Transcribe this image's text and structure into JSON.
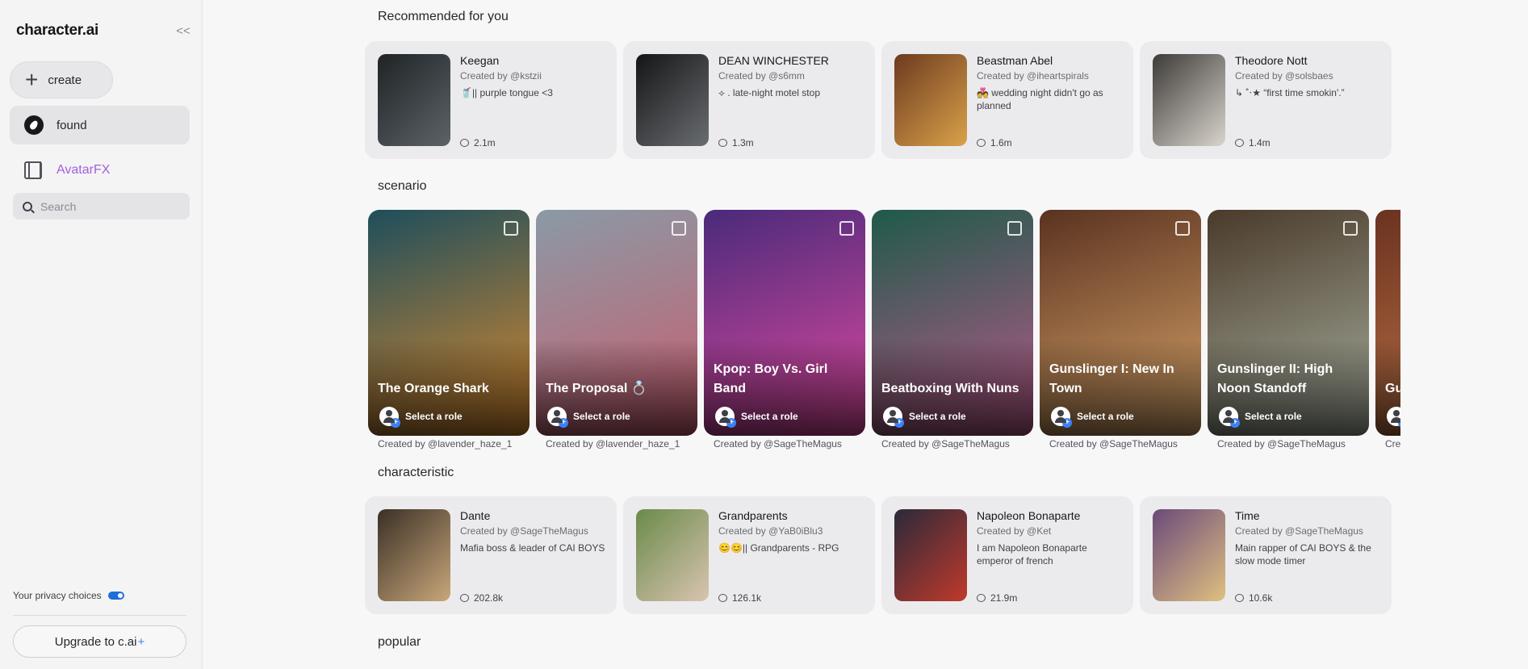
{
  "sidebar": {
    "logo": "character.ai",
    "collapse": "<<",
    "create_label": "create",
    "found_label": "found",
    "avatarfx_label": "AvatarFX",
    "search_placeholder": "Search",
    "privacy_label": "Your privacy choices",
    "upgrade_label": "Upgrade to c.ai",
    "upgrade_plus": "+"
  },
  "sections": {
    "recommended": "Recommended for you",
    "scenario": "scenario",
    "characteristic": "characteristic",
    "popular": "popular"
  },
  "recommended": [
    {
      "name": "Keegan",
      "by": "Created by @kstzii",
      "desc": "🥤|| purple tongue <3",
      "count": "2.1m",
      "colors": [
        "#1f2326",
        "#5c6367"
      ]
    },
    {
      "name": "DEAN WINCHESTER",
      "by": "Created by @s6mm",
      "desc": "⟡ .  late-night motel stop",
      "count": "1.3m",
      "colors": [
        "#141517",
        "#6a6d70"
      ]
    },
    {
      "name": "Beastman Abel",
      "by": "Created by @iheartspirals",
      "desc": "💑 wedding night didn't go as planned",
      "count": "1.6m",
      "colors": [
        "#6d3a1f",
        "#d9a24a"
      ]
    },
    {
      "name": "Theodore Nott",
      "by": "Created by @solsbaes",
      "desc": "↳ ˚‧★ “first time smokin'.”",
      "count": "1.4m",
      "colors": [
        "#3d3b38",
        "#d9d4cd"
      ]
    }
  ],
  "scenarios": [
    {
      "title": "The Orange Shark",
      "role": "Select a role",
      "by": "Created by @lavender_haze_1",
      "colors": [
        "#1e4e5c",
        "#d98a2e"
      ]
    },
    {
      "title": "The Proposal 💍",
      "role": "Select a role",
      "by": "Created by @lavender_haze_1",
      "colors": [
        "#8a9aa6",
        "#c95d6e"
      ]
    },
    {
      "title": "Kpop: Boy Vs. Girl Band",
      "role": "Select a role",
      "by": "Created by @SageTheMagus",
      "colors": [
        "#4a2a7a",
        "#e04aa0"
      ]
    },
    {
      "title": "Beatboxing With Nuns",
      "role": "Select a role",
      "by": "Created by @SageTheMagus",
      "colors": [
        "#1f5a4a",
        "#b95a8a"
      ]
    },
    {
      "title": "Gunslinger I: New In Town",
      "role": "Select a role",
      "by": "Created by @SageTheMagus",
      "colors": [
        "#5a3220",
        "#d9a56a"
      ]
    },
    {
      "title": "Gunslinger II: High Noon Standoff",
      "role": "Select a role",
      "by": "Created by @SageTheMagus",
      "colors": [
        "#4a3a2a",
        "#a8b0a0"
      ]
    },
    {
      "title": "Gu Ca",
      "role": "Select a role",
      "by": "Cre",
      "colors": [
        "#6a3220",
        "#c57a4a"
      ]
    }
  ],
  "characteristic": [
    {
      "name": "Dante",
      "by": "Created by @SageTheMagus",
      "desc": "Mafia boss & leader of CAI BOYS",
      "count": "202.8k",
      "colors": [
        "#3a3026",
        "#c9a77a"
      ]
    },
    {
      "name": "Grandparents",
      "by": "Created by @YaB0iBlu3",
      "desc": "😊😊|| Grandparents - RPG",
      "count": "126.1k",
      "colors": [
        "#6a8a4a",
        "#d9c4b0"
      ]
    },
    {
      "name": "Napoleon Bonaparte",
      "by": "Created by @Ket",
      "desc": "I am Napoleon Bonaparte emperor of french",
      "count": "21.9m",
      "colors": [
        "#2a2a3a",
        "#c0392b"
      ]
    },
    {
      "name": "Time",
      "by": "Created by @SageTheMagus",
      "desc": "Main rapper of CAI BOYS & the slow mode timer",
      "count": "10.6k",
      "colors": [
        "#6a4a7a",
        "#e0c080"
      ]
    }
  ]
}
